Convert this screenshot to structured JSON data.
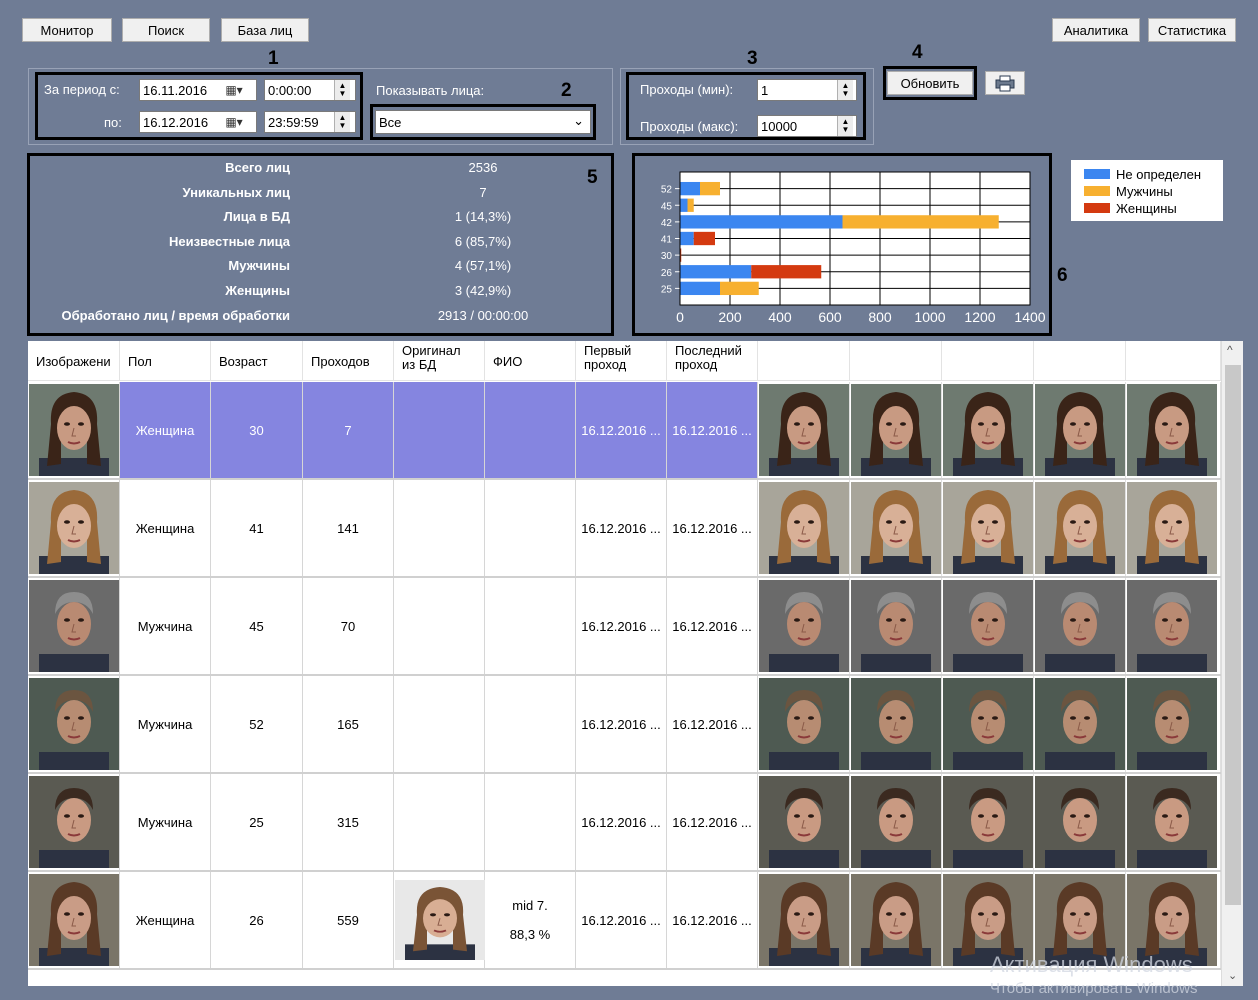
{
  "toolbar": {
    "monitor": "Монитор",
    "search": "Поиск",
    "face_db": "База лиц",
    "analytics": "Аналитика",
    "statistics": "Статистика"
  },
  "callouts": [
    "1",
    "2",
    "3",
    "4",
    "5",
    "6"
  ],
  "period": {
    "from_label": "За период с:",
    "to_label": "по:",
    "from_date": "16.11.2016",
    "from_time": "0:00:00",
    "to_date": "16.12.2016",
    "to_time": "23:59:59"
  },
  "show_faces": {
    "label": "Показывать лица:",
    "value": "Все"
  },
  "passes": {
    "min_label": "Проходы (мин):",
    "min_value": "1",
    "max_label": "Проходы (макс):",
    "max_value": "10000"
  },
  "refresh_button": "Обновить",
  "stats": [
    {
      "label": "Всего лиц",
      "value": "2536"
    },
    {
      "label": "Уникальных лиц",
      "value": "7"
    },
    {
      "label": "Лица в БД",
      "value": "1 (14,3%)"
    },
    {
      "label": "Неизвестные лица",
      "value": "6 (85,7%)"
    },
    {
      "label": "Мужчины",
      "value": "4 (57,1%)"
    },
    {
      "label": "Женщины",
      "value": "3 (42,9%)"
    },
    {
      "label": "Обработано лиц / время обработки",
      "value": "2913 / 00:00:00"
    }
  ],
  "chart_data": {
    "type": "bar",
    "orientation": "horizontal-stacked",
    "categories": [
      "52",
      "45",
      "42",
      "41",
      "30",
      "26",
      "25"
    ],
    "series": [
      {
        "name": "Не определен",
        "color": "#3b86f0",
        "values": [
          80,
          30,
          650,
          55,
          0,
          285,
          160
        ]
      },
      {
        "name": "Мужчины",
        "color": "#f7b030",
        "values": [
          80,
          25,
          625,
          0,
          0,
          0,
          155
        ]
      },
      {
        "name": "Женщины",
        "color": "#d43a10",
        "values": [
          0,
          0,
          0,
          85,
          5,
          280,
          0
        ]
      }
    ],
    "xlim": [
      0,
      1400
    ],
    "xticks": [
      "0",
      "200",
      "400",
      "600",
      "800",
      "1000",
      "1200",
      "1400"
    ],
    "grid": true,
    "legend": "right"
  },
  "table": {
    "headers": [
      "Изображени",
      "Пол",
      "Возраст",
      "Проходов",
      "Оригинал\nиз БД",
      "ФИО",
      "Первый\nпроход",
      "Последний\nпроход"
    ],
    "rows": [
      {
        "gender": "Женщина",
        "age": "30",
        "passes": "7",
        "db": false,
        "fio": "",
        "first": "16.12.2016 ...",
        "last": "16.12.2016 ...",
        "selected": true,
        "skin": "#c89a82",
        "hair": "#3a2418",
        "bg": "#6e7a70"
      },
      {
        "gender": "Женщина",
        "age": "41",
        "passes": "141",
        "db": false,
        "fio": "",
        "first": "16.12.2016 ...",
        "last": "16.12.2016 ...",
        "selected": false,
        "skin": "#d8b097",
        "hair": "#9a6a3a",
        "bg": "#a8a59a"
      },
      {
        "gender": "Мужчина",
        "age": "45",
        "passes": "70",
        "db": false,
        "fio": "",
        "first": "16.12.2016 ...",
        "last": "16.12.2016 ...",
        "selected": false,
        "skin": "#b98a72",
        "hair": "#8d8d8d",
        "bg": "#6a6a6a"
      },
      {
        "gender": "Мужчина",
        "age": "52",
        "passes": "165",
        "db": false,
        "fio": "",
        "first": "16.12.2016 ...",
        "last": "16.12.2016 ...",
        "selected": false,
        "skin": "#b78c72",
        "hair": "#6b5540",
        "bg": "#4e5a52"
      },
      {
        "gender": "Мужчина",
        "age": "25",
        "passes": "315",
        "db": false,
        "fio": "",
        "first": "16.12.2016 ...",
        "last": "16.12.2016 ...",
        "selected": false,
        "skin": "#c99a82",
        "hair": "#3b2a20",
        "bg": "#5a5a52"
      },
      {
        "gender": "Женщина",
        "age": "26",
        "passes": "559",
        "db": true,
        "fio": "mid 7.",
        "fio_score": "88,3 %",
        "first": "16.12.2016 ...",
        "last": "16.12.2016 ...",
        "selected": false,
        "skin": "#c99c86",
        "hair": "#5a3a26",
        "bg": "#7a7568"
      }
    ]
  },
  "watermark": {
    "line1": "Активация Windows",
    "line2": "Чтобы активировать Windows"
  }
}
